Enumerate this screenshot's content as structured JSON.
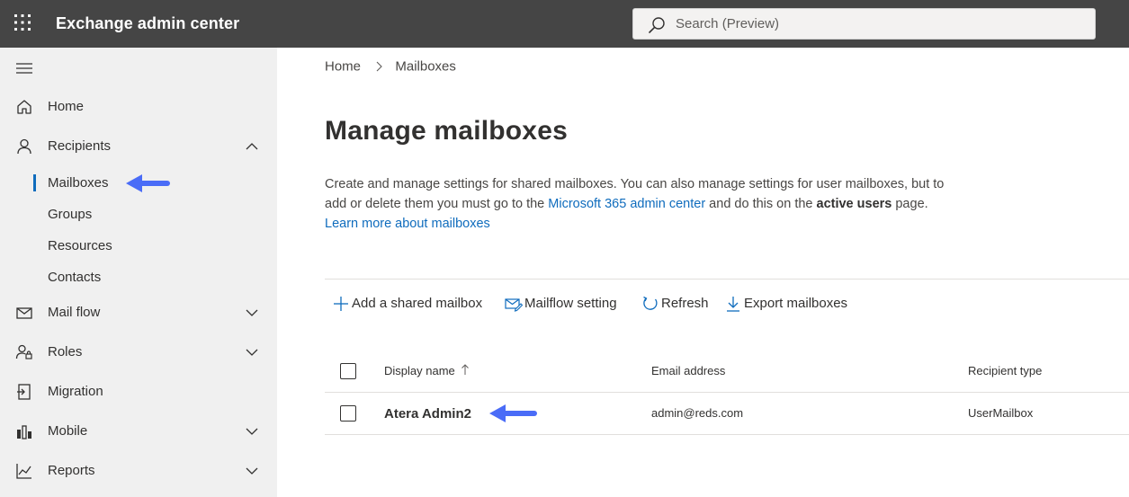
{
  "header": {
    "app_title": "Exchange admin center",
    "search_placeholder": "Search (Preview)"
  },
  "sidebar": {
    "items": [
      {
        "label": "Home",
        "icon": "home-icon"
      },
      {
        "label": "Recipients",
        "icon": "person-icon",
        "expanded": true
      },
      {
        "label": "Mail flow",
        "icon": "mail-icon"
      },
      {
        "label": "Roles",
        "icon": "roles-icon"
      },
      {
        "label": "Migration",
        "icon": "migration-icon"
      },
      {
        "label": "Mobile",
        "icon": "mobile-icon"
      },
      {
        "label": "Reports",
        "icon": "reports-icon"
      }
    ],
    "recipients_sub": [
      "Mailboxes",
      "Groups",
      "Resources",
      "Contacts"
    ],
    "active_sub": "Mailboxes"
  },
  "breadcrumb": {
    "home": "Home",
    "current": "Mailboxes"
  },
  "page": {
    "title": "Manage mailboxes",
    "desc_1": "Create and manage settings for shared mailboxes. You can also manage settings for user mailboxes, but to add or delete them you must go to the ",
    "desc_link_1": "Microsoft 365 admin center",
    "desc_2": " and do this on the ",
    "desc_bold": "active users",
    "desc_3": " page. ",
    "desc_link_2": "Learn more about mailboxes"
  },
  "commands": {
    "add": "Add a shared mailbox",
    "mailflow": "Mailflow setting",
    "refresh": "Refresh",
    "export": "Export mailboxes"
  },
  "table": {
    "columns": [
      "Display name",
      "Email address",
      "Recipient type"
    ],
    "sort_column": "Display name",
    "rows": [
      {
        "display_name": "Atera Admin2",
        "email": "admin@reds.com",
        "type": "UserMailbox"
      }
    ]
  },
  "colors": {
    "topbar": "#454545",
    "sidebar": "#f0f0f0",
    "accent": "#0f6cbd",
    "annotation_arrow": "#4a6cf7"
  }
}
